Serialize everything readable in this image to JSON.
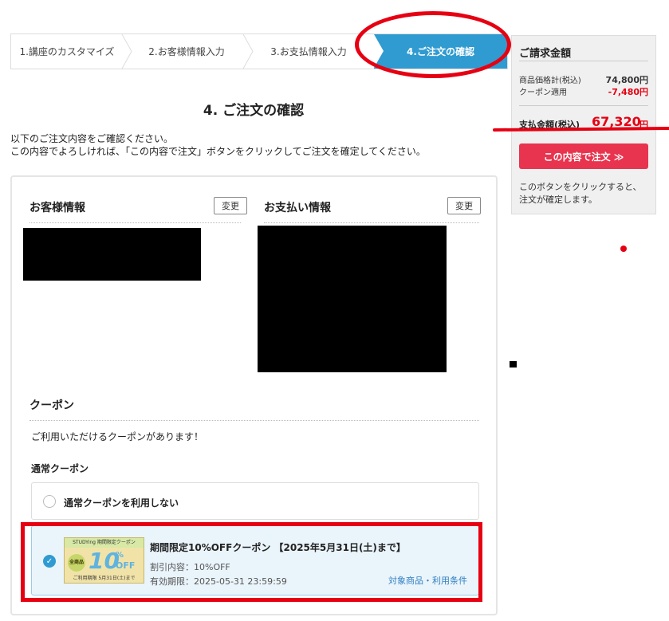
{
  "steps": [
    {
      "label": "1.講座のカスタマイズ"
    },
    {
      "label": "2.お客様情報入力"
    },
    {
      "label": "3.お支払情報入力"
    },
    {
      "label": "4.ご注文の確認"
    }
  ],
  "heading": "4. ご注文の確認",
  "intro": {
    "line1": "以下のご注文内容をご確認ください。",
    "line2": "この内容でよろしければ、「この内容で注文」ボタンをクリックしてご注文を確定してください。"
  },
  "customer": {
    "title": "お客様情報",
    "change_label": "変更"
  },
  "payment": {
    "title": "お支払い情報",
    "change_label": "変更"
  },
  "coupon": {
    "title": "クーポン",
    "note": "ご利用いただけるクーポンがあります！",
    "subtitle": "通常クーポン",
    "none_label": "通常クーポンを利用しない",
    "item": {
      "title": "期間限定10%OFFクーポン 【2025年5月31日(土)まで】",
      "discount": "割引内容：10%OFF",
      "expiry": "有効期限：2025-05-31 23:59:59",
      "link": "対象商品・利用条件",
      "image": {
        "top": "STUDYing 期間限定クーポン",
        "left": "全商品",
        "big": "10",
        "pct": "%",
        "off": "OFF",
        "bottom": "ご利用期限 5月31日(土)まで"
      }
    }
  },
  "summary": {
    "title": "ご請求金額",
    "subtotal_label": "商品価格計(税込)",
    "subtotal_value": "74,800円",
    "coupon_label": "クーポン適用",
    "coupon_value": "-7,480円",
    "total_label": "支払金額(税込)",
    "total_value": "67,320",
    "total_unit": "円",
    "order_button": "この内容で注文 ≫",
    "note": "このボタンをクリックすると、注文が確定します。"
  },
  "colors": {
    "accent_blue": "#2f9bd1",
    "order_red": "#e8344e",
    "annotation_red": "#e60012"
  }
}
